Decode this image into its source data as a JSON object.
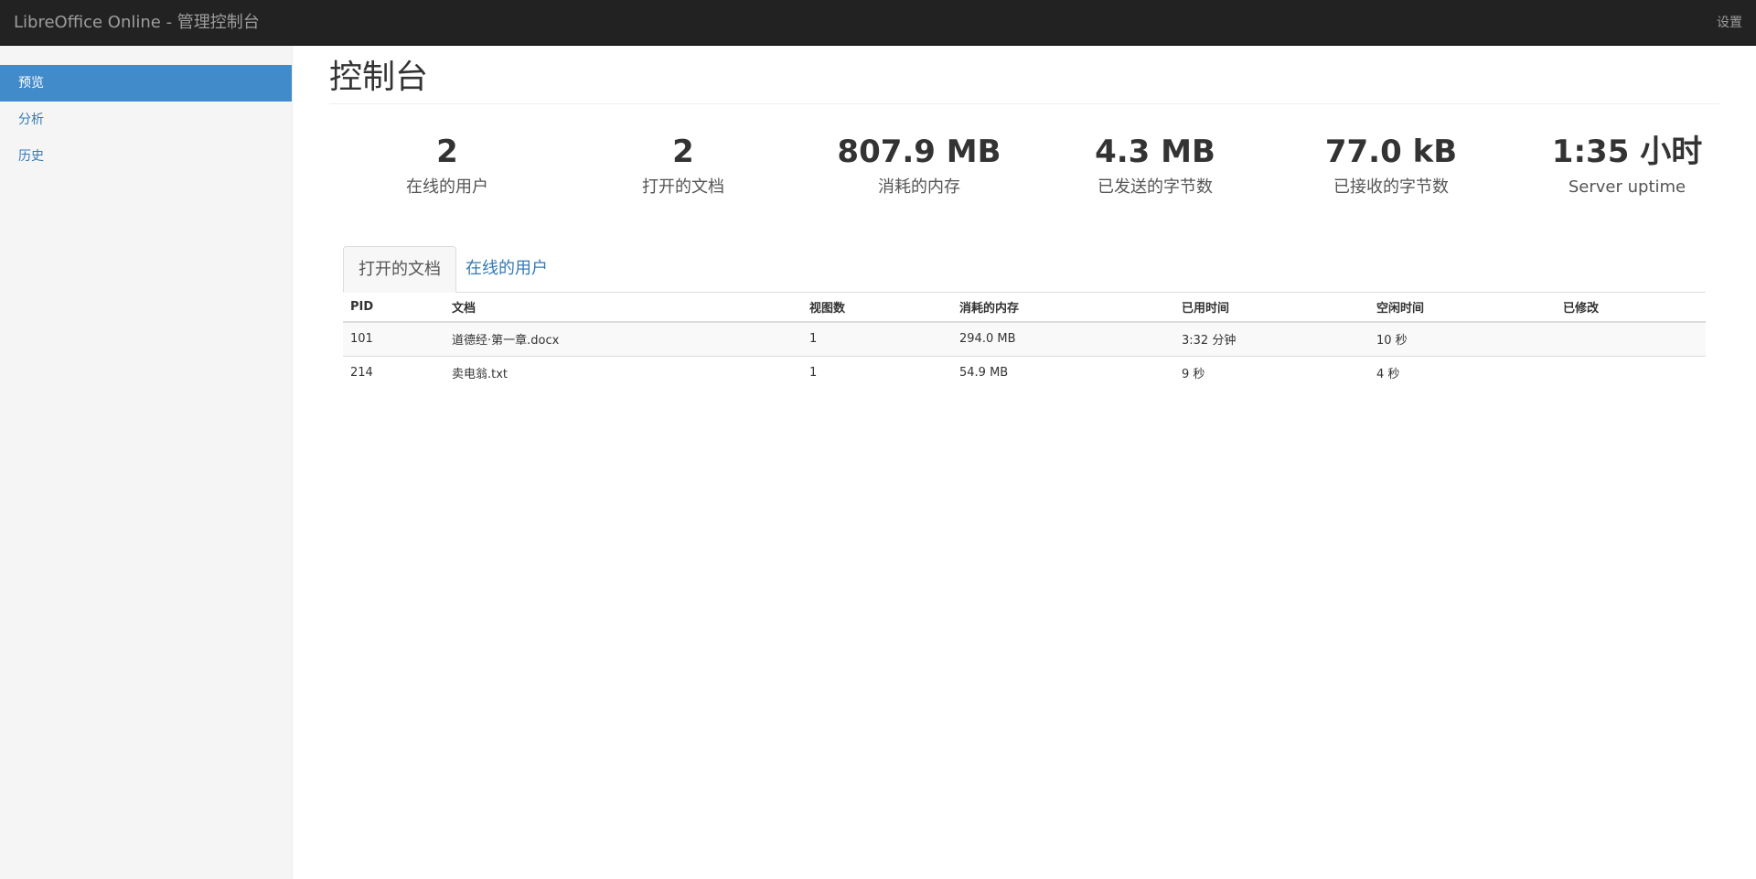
{
  "navbar": {
    "brand": "LibreOffice Online - 管理控制台",
    "settings_label": "设置"
  },
  "sidebar": {
    "items": [
      {
        "label": "预览"
      },
      {
        "label": "分析"
      },
      {
        "label": "历史"
      }
    ]
  },
  "main": {
    "title": "控制台",
    "stats": [
      {
        "value": "2",
        "label": "在线的用户"
      },
      {
        "value": "2",
        "label": "打开的文档"
      },
      {
        "value": "807.9 MB",
        "label": "消耗的内存"
      },
      {
        "value": "4.3 MB",
        "label": "已发送的字节数"
      },
      {
        "value": "77.0 kB",
        "label": "已接收的字节数"
      },
      {
        "value": "1:35 小时",
        "label": "Server uptime"
      }
    ],
    "tabs": [
      {
        "label": "打开的文档"
      },
      {
        "label": "在线的用户"
      }
    ],
    "table": {
      "headers": [
        "PID",
        "文档",
        "视图数",
        "消耗的内存",
        "已用时间",
        "空闲时间",
        "已修改"
      ],
      "rows": [
        [
          "101",
          "道德经·第一章.docx",
          "1",
          "294.0 MB",
          "3:32 分钟",
          "10 秒",
          ""
        ],
        [
          "214",
          "卖电翁.txt",
          "1",
          "54.9 MB",
          "9 秒",
          "4 秒",
          ""
        ]
      ]
    }
  }
}
